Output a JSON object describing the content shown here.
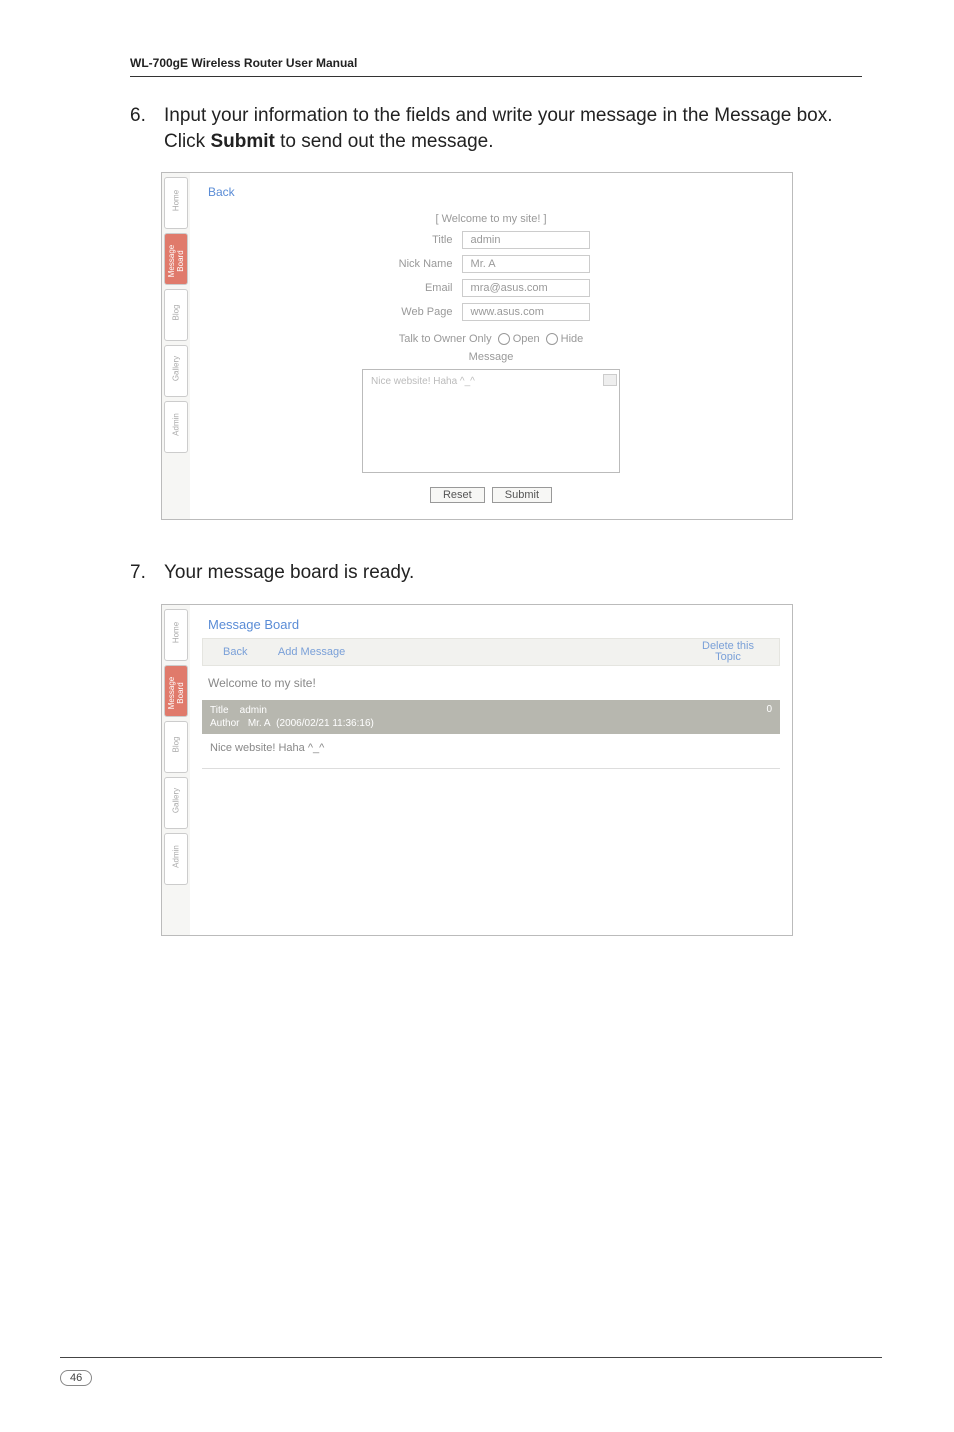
{
  "doc": {
    "header": "WL-700gE Wireless Router User Manual",
    "page_number": "46"
  },
  "step6": {
    "num": "6.",
    "text_before": "Input your information to the fields and write your message in the Message box. Click ",
    "text_bold": "Submit",
    "text_after": " to send out the message."
  },
  "step7": {
    "num": "7.",
    "text": "Your message board is ready."
  },
  "shot1": {
    "back": "Back",
    "heading": "[ Welcome to my site! ]",
    "fields": {
      "title_lbl": "Title",
      "title_val": "admin",
      "nick_lbl": "Nick Name",
      "nick_val": "Mr. A",
      "email_lbl": "Email",
      "email_val": "mra@asus.com",
      "web_lbl": "Web Page",
      "web_val": "www.asus.com"
    },
    "radio_label": "Talk to Owner Only",
    "radio_open": "Open",
    "radio_hide": "Hide",
    "message_lbl": "Message",
    "message_val": "Nice website! Haha ^_^",
    "reset": "Reset",
    "submit": "Submit"
  },
  "shot2": {
    "title": "Message Board",
    "back": "Back",
    "add": "Add Message",
    "delete_top": "Delete this",
    "delete_bottom": "Topic",
    "welcome": "Welcome to my site!",
    "hdr_title_lbl": "Title",
    "hdr_title_val": "admin",
    "hdr_author_lbl": "Author",
    "hdr_author_val": "Mr. A",
    "hdr_meta": "(2006/02/21 11:36:16)",
    "hdr_right": "0",
    "body": "Nice website! Haha ^_^"
  },
  "sidetabs": {
    "t1": "Home",
    "t2": "Message Board",
    "t3": "Blog",
    "t4": "Gallery",
    "t5": "Admin"
  }
}
